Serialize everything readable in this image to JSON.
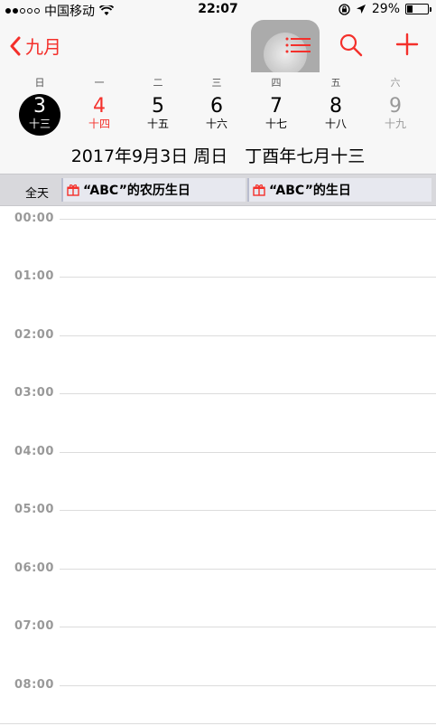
{
  "status_bar": {
    "carrier": "中国移动",
    "time": "22:07",
    "battery_text": "29%",
    "battery_level": 0.29,
    "icons": [
      "signal-dots-icon",
      "wifi-icon",
      "orientation-lock-icon",
      "location-arrow-icon",
      "battery-icon"
    ]
  },
  "nav": {
    "back_label": "九月",
    "back_icon": "chevron-left-icon",
    "actions": [
      "list-icon",
      "search-icon",
      "add-icon"
    ],
    "accent_color": "#f4302b"
  },
  "week": {
    "weekday_labels": [
      "日",
      "一",
      "二",
      "三",
      "四",
      "五",
      "六"
    ],
    "days": [
      {
        "num": "3",
        "lunar": "十三",
        "state": "selected"
      },
      {
        "num": "4",
        "lunar": "十四",
        "state": "today"
      },
      {
        "num": "5",
        "lunar": "十五",
        "state": "normal"
      },
      {
        "num": "6",
        "lunar": "十六",
        "state": "normal"
      },
      {
        "num": "7",
        "lunar": "十七",
        "state": "normal"
      },
      {
        "num": "8",
        "lunar": "十八",
        "state": "normal"
      },
      {
        "num": "9",
        "lunar": "十九",
        "state": "weekend"
      }
    ],
    "date_line": "2017年9月3日 周日　丁酉年七月十三"
  },
  "all_day": {
    "label": "全天",
    "events": [
      {
        "title": "“ABC”的农历生日",
        "icon": "gift-icon"
      },
      {
        "title": "“ABC”的生日",
        "icon": "gift-icon"
      }
    ]
  },
  "hours": [
    "00:00",
    "01:00",
    "02:00",
    "03:00",
    "04:00",
    "05:00",
    "06:00",
    "07:00",
    "08:00"
  ]
}
